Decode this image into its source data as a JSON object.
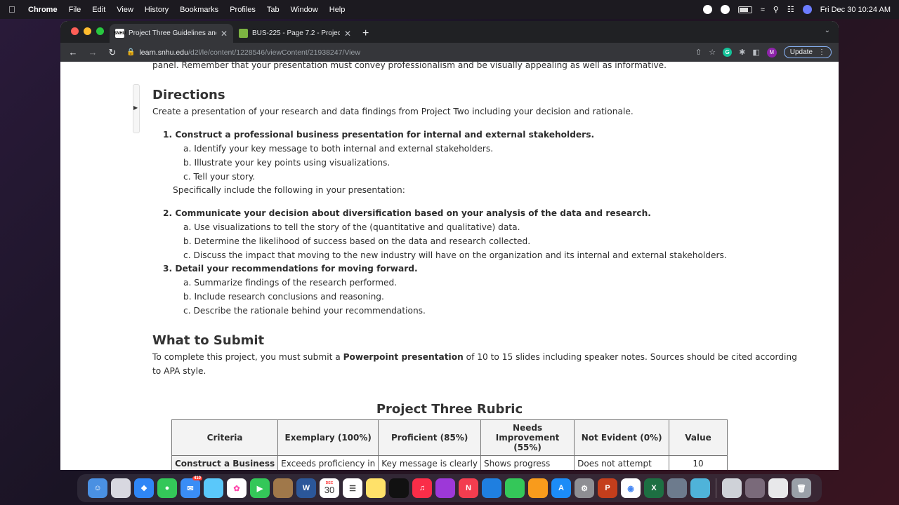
{
  "menubar": {
    "items": [
      "Chrome",
      "File",
      "Edit",
      "View",
      "History",
      "Bookmarks",
      "Profiles",
      "Tab",
      "Window",
      "Help"
    ],
    "datetime": "Fri Dec 30  10:24 AM"
  },
  "tabs": [
    {
      "title": "Project Three Guidelines and R",
      "favicon": "SNHU"
    },
    {
      "title": "BUS-225 - Page 7.2 - Project T"
    }
  ],
  "address": {
    "host": "learn.snhu.edu",
    "path": "/d2l/le/content/1228546/viewContent/21938247/View"
  },
  "update_label": "Update",
  "avatar_letter": "M",
  "grammarly_letter": "G",
  "page": {
    "intro_tail": "panel. Remember that your presentation must convey professionalism and be visually appealing as well as informative.",
    "directions_heading": "Directions",
    "directions_text": "Create a presentation of your research and data findings from Project Two including your decision and rationale.",
    "item1": "1. Construct a professional business presentation for internal and external stakeholders.",
    "item1a": "a. Identify your key message to both internal and external stakeholders.",
    "item1b": "b. Illustrate your key points using visualizations.",
    "item1c": "c. Tell your story.",
    "item1_note": "Specifically include the following in your presentation:",
    "item2": "2. Communicate your decision about diversification based on your analysis of the data and research.",
    "item2a": "a. Use visualizations to tell the story of the (quantitative and qualitative) data.",
    "item2b": "b. Determine the likelihood of success based on the data and research collected.",
    "item2c": "c. Discuss the impact that moving to the new industry will have on the organization and its internal and external stakeholders.",
    "item3": "3. Detail your recommendations for moving forward.",
    "item3a": "a. Summarize findings of the research performed.",
    "item3b": "b. Include research conclusions and reasoning.",
    "item3c": "c. Describe the rationale behind your recommendations.",
    "submit_heading": "What to Submit",
    "submit_pre": "To complete this project, you must submit a ",
    "submit_bold": "Powerpoint presentation",
    "submit_post": " of 10 to 15 slides including speaker notes. Sources should be cited according",
    "submit_line2": "to APA style.",
    "rubric_title": "Project Three Rubric",
    "rubric_headers": [
      "Criteria",
      "Exemplary (100%)",
      "Proficient (85%)",
      "Needs Improvement (55%)",
      "Not Evident (0%)",
      "Value"
    ],
    "rubric_row1": [
      "Construct a Business",
      "Exceeds proficiency in",
      "Key message is clearly",
      "Shows progress",
      "Does not attempt",
      "10"
    ]
  },
  "dock": {
    "mail_badge": "410",
    "calendar_month": "DEC",
    "calendar_day": "30"
  }
}
